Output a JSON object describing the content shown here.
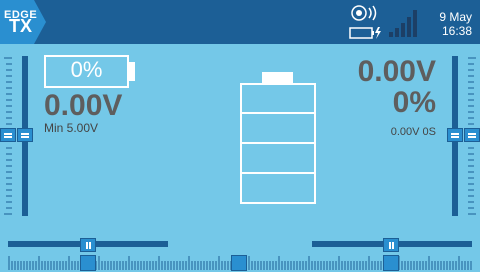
{
  "header": {
    "logo_line1": "EDGE",
    "logo_line2": "TX",
    "date": "9 May",
    "time": "16:38",
    "icons": [
      "speaker-icon",
      "battery-charging-icon",
      "signal-bars-icon"
    ]
  },
  "left_widget": {
    "percent_label": "0%",
    "voltage": "0.00V",
    "min_label": "Min 5.00V"
  },
  "right_widget": {
    "voltage": "0.00V",
    "percent": "0%",
    "detail": "0.00V 0S"
  },
  "colors": {
    "background": "#74c8e8",
    "topbar": "#1c5f96",
    "accent": "#2a8fd0",
    "value_text": "#5e5e5e"
  }
}
